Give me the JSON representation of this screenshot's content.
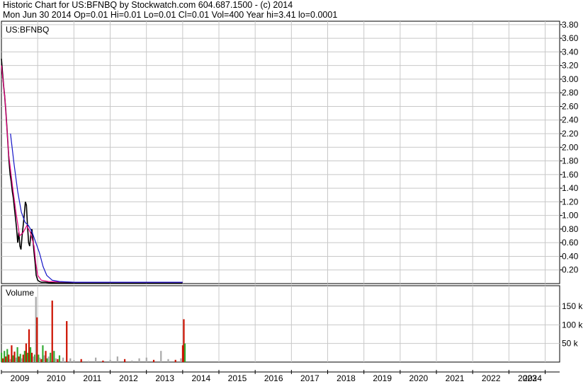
{
  "header": {
    "line1": "Historic Chart for US:BFNBQ by Stockwatch.com 604.687.1500 - (c) 2014",
    "line2": "Mon Jun 30 2014  Op=0.01  Hi=0.01  Lo=0.01  Cl=0.01  Vol=400  Year hi=3.41  lo=0.0001"
  },
  "colors": {
    "price": "#000000",
    "ma_short": "#e6007e",
    "ma_long": "#1515c8",
    "vol_up": "#33aa33",
    "vol_down": "#cc1100",
    "vol_flat": "#aaaaaa",
    "grid": "#c8c8c8"
  },
  "chart_data": [
    {
      "type": "line",
      "title": "US:BFNBQ",
      "y_ticks": [
        "0.20",
        "0.40",
        "0.60",
        "0.80",
        "1.00",
        "1.20",
        "1.40",
        "1.60",
        "1.80",
        "2.00",
        "2.20",
        "2.40",
        "2.60",
        "2.80",
        "3.00",
        "3.20",
        "3.40",
        "3.60",
        "3.80"
      ],
      "ylim": [
        0.0,
        3.85
      ],
      "x_ticks": [
        "2009",
        "2010",
        "2011",
        "2012",
        "2013",
        "2014",
        "2015",
        "2016",
        "2017",
        "2018",
        "2019",
        "2020",
        "2021",
        "2022",
        "2023",
        "2024"
      ],
      "xlim": [
        2009.0,
        2024.4
      ],
      "series": [
        {
          "role": "price",
          "x": [
            2009.0,
            2009.03,
            2009.06,
            2009.09,
            2009.12,
            2009.15,
            2009.18,
            2009.21,
            2009.24,
            2009.27,
            2009.3,
            2009.33,
            2009.36,
            2009.39,
            2009.42,
            2009.45,
            2009.48,
            2009.51,
            2009.54,
            2009.57,
            2009.6,
            2009.63,
            2009.66,
            2009.69,
            2009.72,
            2009.75,
            2009.78,
            2009.81,
            2009.84,
            2009.87,
            2009.9,
            2009.93,
            2009.96,
            2010.0,
            2010.05,
            2010.1,
            2010.2,
            2010.3,
            2010.5,
            2010.8,
            2011.5,
            2012.5,
            2013.5,
            2014.0
          ],
          "values": [
            3.3,
            3.1,
            2.9,
            2.75,
            2.55,
            2.3,
            2.05,
            1.8,
            1.6,
            1.5,
            1.35,
            1.25,
            1.1,
            0.95,
            0.8,
            0.6,
            0.75,
            0.55,
            0.5,
            0.7,
            0.85,
            1.0,
            1.2,
            1.15,
            0.85,
            0.6,
            0.55,
            0.7,
            0.8,
            0.65,
            0.45,
            0.3,
            0.12,
            0.05,
            0.03,
            0.02,
            0.02,
            0.015,
            0.01,
            0.01,
            0.01,
            0.01,
            0.01,
            0.01
          ]
        },
        {
          "role": "moving-average-short",
          "x": [
            2009.0,
            2009.1,
            2009.2,
            2009.3,
            2009.4,
            2009.5,
            2009.6,
            2009.7,
            2009.8,
            2009.85,
            2009.9,
            2009.95,
            2010.0,
            2010.1,
            2010.3,
            2011.0,
            2012.0,
            2013.0,
            2014.0
          ],
          "values": [
            3.2,
            2.7,
            1.9,
            1.45,
            1.05,
            0.7,
            0.75,
            0.85,
            0.75,
            0.65,
            0.55,
            0.3,
            0.12,
            0.05,
            0.03,
            0.02,
            0.02,
            0.02,
            0.02
          ]
        },
        {
          "role": "moving-average-long",
          "x": [
            2009.25,
            2009.35,
            2009.45,
            2009.55,
            2009.65,
            2009.75,
            2009.85,
            2009.95,
            2010.05,
            2010.15,
            2010.25,
            2010.4,
            2010.6,
            2011.0,
            2012.0,
            2013.0,
            2014.0
          ],
          "values": [
            2.2,
            1.75,
            1.35,
            1.05,
            0.9,
            0.85,
            0.75,
            0.6,
            0.45,
            0.25,
            0.12,
            0.05,
            0.03,
            0.02,
            0.02,
            0.02,
            0.02
          ]
        }
      ]
    },
    {
      "type": "bar",
      "title": "Volume",
      "y_ticks": [
        "50 k",
        "100 k",
        "150 k"
      ],
      "ylim": [
        0,
        205000
      ],
      "x": [
        2009.0,
        2009.04,
        2009.08,
        2009.12,
        2009.16,
        2009.2,
        2009.24,
        2009.28,
        2009.32,
        2009.36,
        2009.4,
        2009.44,
        2009.48,
        2009.52,
        2009.56,
        2009.6,
        2009.64,
        2009.68,
        2009.72,
        2009.76,
        2009.8,
        2009.84,
        2009.88,
        2009.92,
        2009.95,
        2009.98,
        2010.02,
        2010.06,
        2010.1,
        2010.14,
        2010.18,
        2010.22,
        2010.26,
        2010.3,
        2010.35,
        2010.4,
        2010.45,
        2010.5,
        2010.55,
        2010.6,
        2010.7,
        2010.8,
        2010.9,
        2011.0,
        2011.2,
        2011.4,
        2011.6,
        2011.8,
        2012.0,
        2012.2,
        2012.4,
        2012.6,
        2012.8,
        2013.0,
        2013.2,
        2013.4,
        2013.6,
        2013.8,
        2013.95,
        2014.0,
        2014.03,
        2014.06
      ],
      "values": [
        25000,
        10000,
        30000,
        15000,
        35000,
        20000,
        8000,
        45000,
        18000,
        28000,
        12000,
        40000,
        15000,
        22000,
        10000,
        20000,
        30000,
        50000,
        25000,
        88000,
        40000,
        25000,
        15000,
        20000,
        175000,
        120000,
        20000,
        12000,
        8000,
        45000,
        18000,
        30000,
        10000,
        15000,
        25000,
        165000,
        30000,
        10000,
        8000,
        18000,
        12000,
        110000,
        10000,
        5000,
        8000,
        3000,
        12000,
        4000,
        6000,
        15000,
        8000,
        4000,
        10000,
        12000,
        6000,
        30000,
        8000,
        6000,
        10000,
        45000,
        115000,
        50000
      ],
      "colors": [
        "#33aa33",
        "#cc1100",
        "#33aa33",
        "#cc1100",
        "#33aa33",
        "#cc1100",
        "#aaaaaa",
        "#cc1100",
        "#33aa33",
        "#cc1100",
        "#aaaaaa",
        "#33aa33",
        "#cc1100",
        "#33aa33",
        "#aaaaaa",
        "#cc1100",
        "#33aa33",
        "#cc1100",
        "#33aa33",
        "#cc1100",
        "#33aa33",
        "#cc1100",
        "#aaaaaa",
        "#33aa33",
        "#aaaaaa",
        "#cc1100",
        "#33aa33",
        "#aaaaaa",
        "#cc1100",
        "#33aa33",
        "#aaaaaa",
        "#cc1100",
        "#33aa33",
        "#aaaaaa",
        "#33aa33",
        "#cc1100",
        "#33aa33",
        "#aaaaaa",
        "#cc1100",
        "#33aa33",
        "#aaaaaa",
        "#cc1100",
        "#aaaaaa",
        "#aaaaaa",
        "#cc1100",
        "#aaaaaa",
        "#aaaaaa",
        "#cc1100",
        "#aaaaaa",
        "#aaaaaa",
        "#cc1100",
        "#aaaaaa",
        "#aaaaaa",
        "#aaaaaa",
        "#cc1100",
        "#aaaaaa",
        "#aaaaaa",
        "#cc1100",
        "#aaaaaa",
        "#cc1100",
        "#cc1100",
        "#33aa33"
      ]
    }
  ]
}
